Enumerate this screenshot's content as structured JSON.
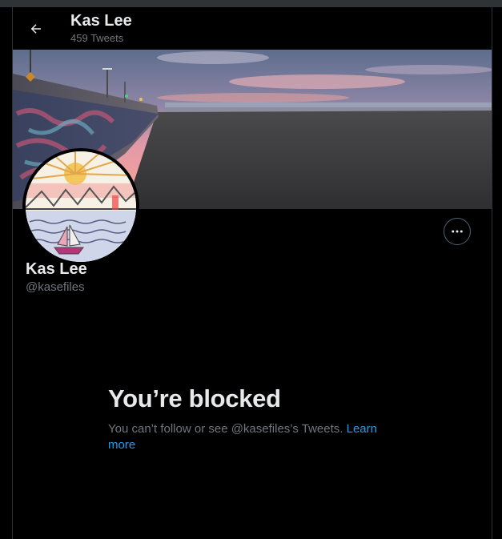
{
  "header": {
    "name": "Kas Lee",
    "tweet_count": "459 Tweets",
    "back_icon": "arrow-left-icon"
  },
  "profile": {
    "name": "Kas Lee",
    "handle": "@kasefiles",
    "more_icon": "more-horizontal-icon"
  },
  "blocked": {
    "title": "You’re blocked",
    "body": "You can’t follow or see @kasefiles’s Tweets.",
    "link": "Learn more"
  },
  "colors": {
    "background": "#000000",
    "text_primary": "#e7e9ea",
    "text_secondary": "#71767b",
    "link": "#1d9bf0",
    "border": "#2f3336"
  }
}
